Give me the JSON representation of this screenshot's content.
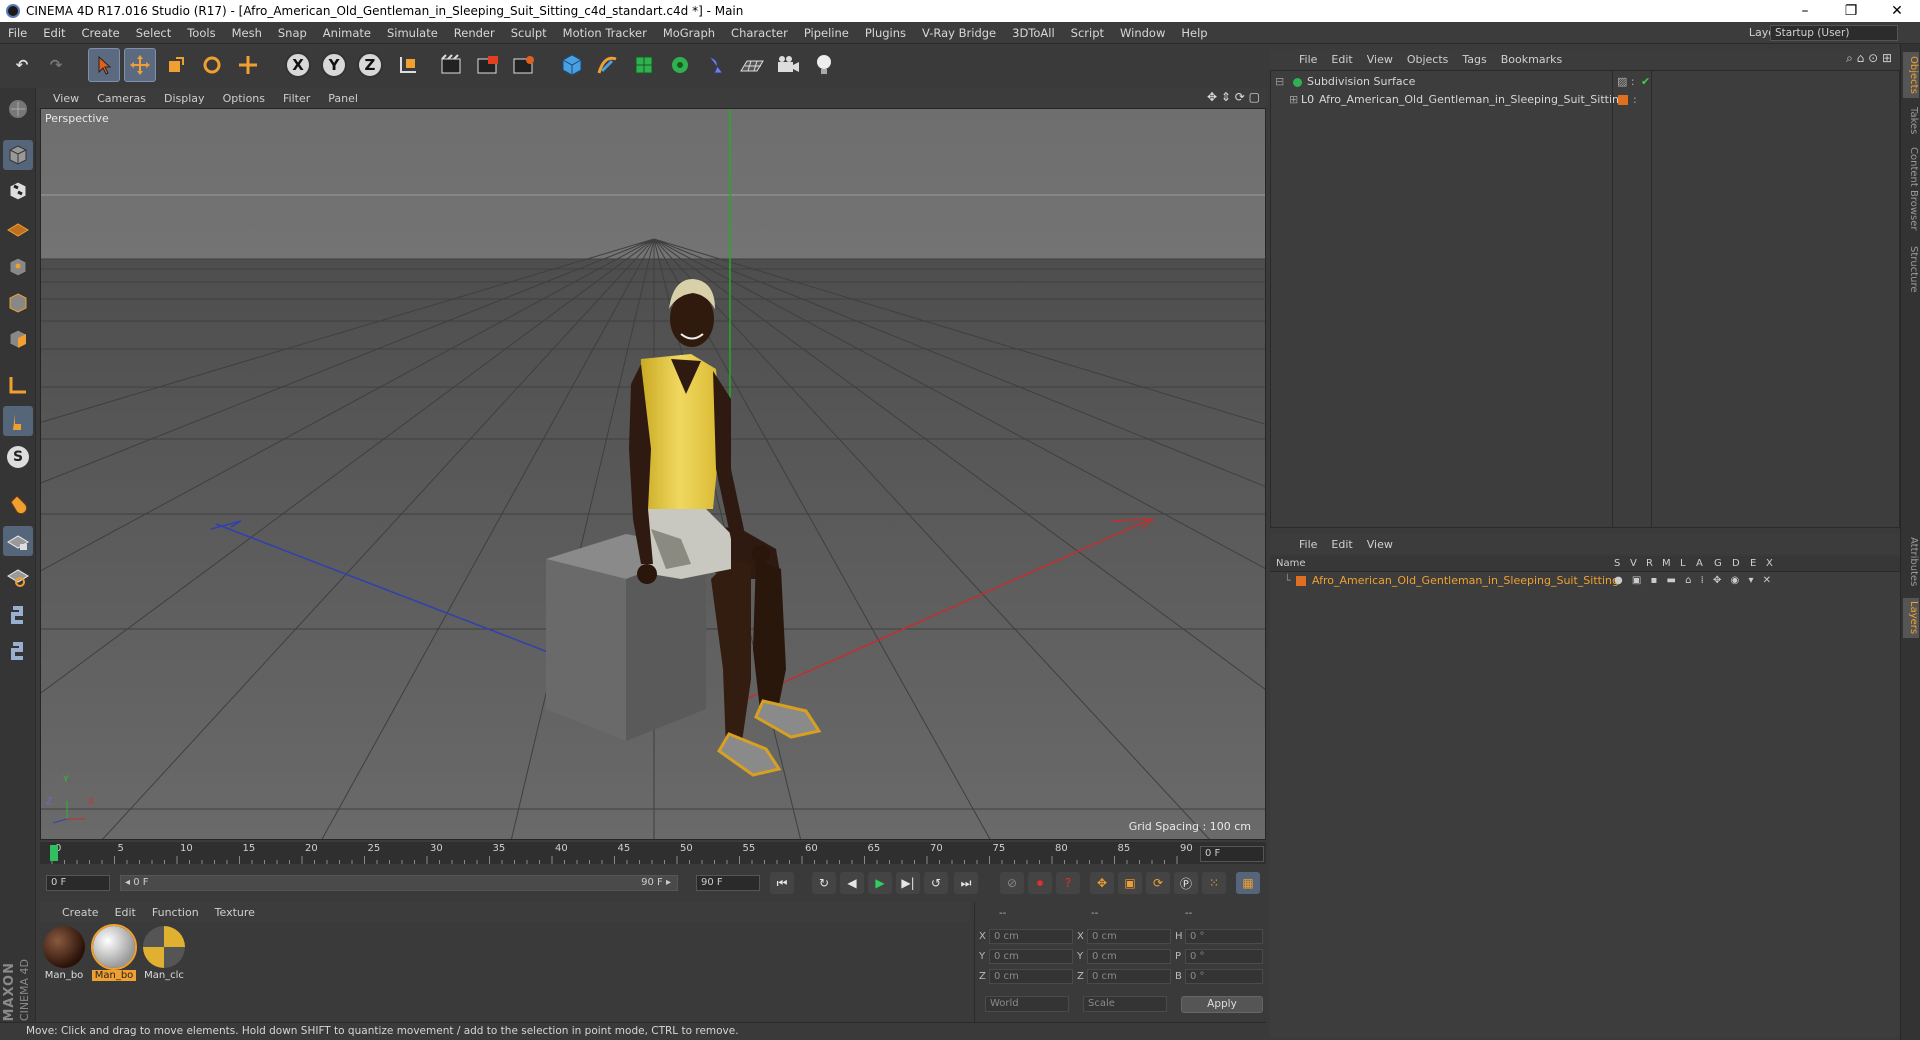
{
  "window": {
    "title": "CINEMA 4D R17.016 Studio (R17) - [Afro_American_Old_Gentleman_in_Sleeping_Suit_Sitting_c4d_standart.c4d *] - Main",
    "minimize": "–",
    "restore": "❐",
    "close": "✕"
  },
  "menubar": {
    "items": [
      "File",
      "Edit",
      "Create",
      "Select",
      "Tools",
      "Mesh",
      "Snap",
      "Animate",
      "Simulate",
      "Render",
      "Sculpt",
      "Motion Tracker",
      "MoGraph",
      "Character",
      "Pipeline",
      "Plugins",
      "V-Ray Bridge",
      "3DToAll",
      "Script",
      "Window",
      "Help"
    ],
    "layout_label": "Layout:",
    "layout_value": "Startup (User)"
  },
  "toolbar": {
    "axis_x": "X",
    "axis_y": "Y",
    "axis_z": "Z"
  },
  "viewport": {
    "menu": [
      "View",
      "Cameras",
      "Display",
      "Options",
      "Filter",
      "Panel"
    ],
    "label": "Perspective",
    "grid_spacing": "Grid Spacing : 100 cm",
    "axis_y": "Y",
    "axis_x": "X",
    "axis_z": "Z"
  },
  "timeline": {
    "ticks": [
      "0",
      "5",
      "10",
      "15",
      "20",
      "25",
      "30",
      "35",
      "40",
      "45",
      "50",
      "55",
      "60",
      "65",
      "70",
      "75",
      "80",
      "85",
      "90"
    ],
    "current_frame": "0 F",
    "progress": 0.0
  },
  "transport": {
    "start_field": "0 F",
    "range_left": "◂ 0 F",
    "range_right": "90 F ▸",
    "end_field": "90 F"
  },
  "materials": {
    "menu": [
      "Create",
      "Edit",
      "Function",
      "Texture"
    ],
    "items": [
      {
        "label": "Man_bo",
        "selected": false
      },
      {
        "label": "Man_bo",
        "selected": true
      },
      {
        "label": "Man_clc",
        "selected": false
      }
    ]
  },
  "coordinates": {
    "header": [
      "--",
      "--",
      "--"
    ],
    "rows": [
      {
        "a": "X",
        "av": "0 cm",
        "b": "X",
        "bv": "0 cm",
        "c": "H",
        "cv": "0 °"
      },
      {
        "a": "Y",
        "av": "0 cm",
        "b": "Y",
        "bv": "0 cm",
        "c": "P",
        "cv": "0 °"
      },
      {
        "a": "Z",
        "av": "0 cm",
        "b": "Z",
        "bv": "0 cm",
        "c": "B",
        "cv": "0 °"
      }
    ],
    "mode1": "World",
    "mode2": "Scale",
    "apply": "Apply"
  },
  "statusbar": {
    "text": "Move: Click and drag to move elements. Hold down SHIFT to quantize movement / add to the selection in point mode, CTRL to remove."
  },
  "object_manager": {
    "menu": [
      "File",
      "Edit",
      "View",
      "Objects",
      "Tags",
      "Bookmarks"
    ],
    "objects": [
      {
        "name": "Subdivision Surface"
      },
      {
        "name": "Afro_American_Old_Gentleman_in_Sleeping_Suit_Sitting"
      }
    ]
  },
  "layer_manager": {
    "menu": [
      "File",
      "Edit",
      "View"
    ],
    "columns": [
      "Name",
      "S",
      "V",
      "R",
      "M",
      "L",
      "A",
      "G",
      "D",
      "E",
      "X"
    ],
    "layers": [
      {
        "name": "Afro_American_Old_Gentleman_in_Sleeping_Suit_Sitting",
        "color": "#e07020"
      }
    ]
  },
  "side_tabs": [
    "Objects",
    "Takes",
    "Content Browser",
    "Structure",
    "Attributes",
    "Layers"
  ],
  "maxon": {
    "line1": "MAXON",
    "line2": "CINEMA 4D"
  },
  "colors": {
    "accent_orange": "#f0a030",
    "layer_text": "#f0a030",
    "axis_x": "#d03030",
    "axis_y": "#30c030",
    "axis_z": "#3050d0"
  }
}
